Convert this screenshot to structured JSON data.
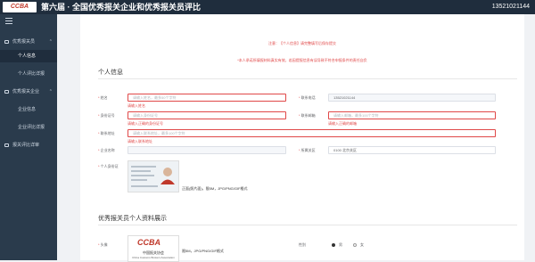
{
  "header": {
    "logo_text": "CCBA",
    "title": "第六届 · 全国优秀报关企业和优秀报关员评比",
    "phone": "13521021144"
  },
  "sidebar": {
    "items": [
      {
        "label": "优秀报关员",
        "type": "group",
        "expanded": true
      },
      {
        "label": "个人信息",
        "type": "sub",
        "active": true
      },
      {
        "label": "个人评比详报",
        "type": "sub"
      },
      {
        "label": "优秀报关企业",
        "type": "group",
        "expanded": true
      },
      {
        "label": "企业信息",
        "type": "sub"
      },
      {
        "label": "企业评比详报",
        "type": "sub"
      },
      {
        "label": "报关评比详审",
        "type": "group"
      }
    ]
  },
  "notes": {
    "line1": "注意：【个人信息】请完整填写后保存提交",
    "line2": "*本人承诺所填报材料真实有效，若因提报信息有误导致不符合申报条件的责任自负"
  },
  "personal": {
    "section_title": "个人信息",
    "name": {
      "label": "姓名",
      "placeholder": "请输入姓名，最多50个字符",
      "error": "请输入姓名"
    },
    "contact": {
      "label": "联系电话",
      "value": "13521021144"
    },
    "id_number": {
      "label": "身份证号",
      "placeholder": "请输入身份证号",
      "error": "请输入正确的身份证号"
    },
    "email": {
      "label": "联系邮箱",
      "placeholder": "请输入邮箱，最多100个字符",
      "error": "请输入正确的邮箱"
    },
    "address": {
      "label": "联系地址",
      "placeholder": "请输入联系地址，最多100个字符",
      "error": "请输入联系地址"
    },
    "company": {
      "label": "企业名称"
    },
    "region": {
      "label": "所属关区",
      "value": "0100  北京关区"
    },
    "id_photo": {
      "label": "个人身份证",
      "hint": "正面(照片面)，限5M，JPG/PNG/GIF格式"
    }
  },
  "showcase": {
    "section_title": "优秀报关员个人资料展示",
    "avatar": {
      "label": "头像",
      "logo_text": "CCBA",
      "logo_subtitle": "中国报关协会",
      "logo_en": "China Customs Brokers Association",
      "hint": "限5M，JPG/PNG/GIF格式"
    },
    "gender": {
      "label": "性别",
      "options": [
        "男",
        "女"
      ],
      "selected": "男"
    }
  }
}
